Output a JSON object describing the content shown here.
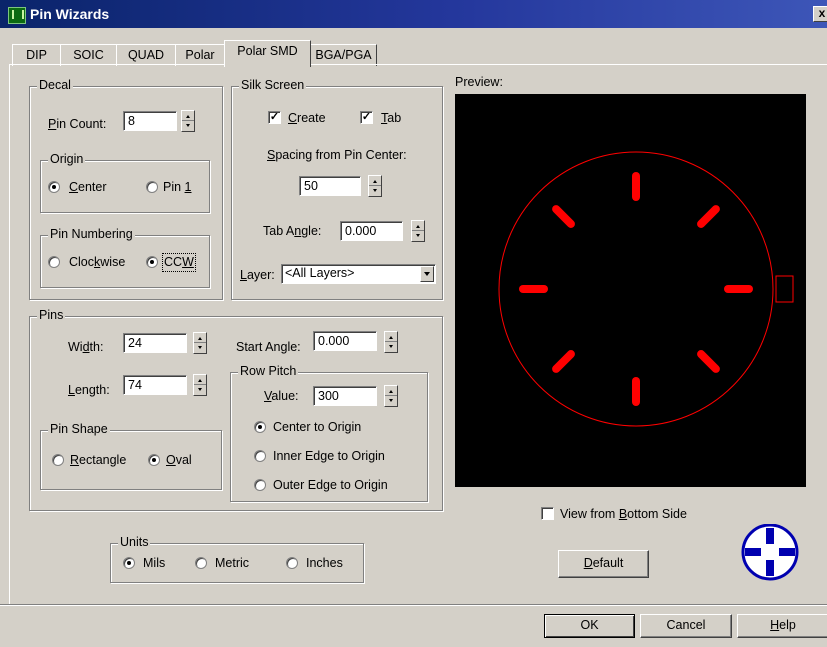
{
  "window": {
    "title": "Pin Wizards",
    "close_label": "x"
  },
  "tabs": [
    "DIP",
    "SOIC",
    "QUAD",
    "Polar",
    "Polar SMD",
    "BGA/PGA"
  ],
  "selected_tab": "Polar SMD",
  "decal": {
    "label": "Decal",
    "pin_count_label": "Pin Count:",
    "pin_count": "8",
    "origin": {
      "label": "Origin",
      "options": [
        "Center",
        "Pin 1"
      ],
      "selected": "Center"
    },
    "pin_numbering": {
      "label": "Pin Numbering",
      "options": [
        "Clockwise",
        "CCW"
      ],
      "selected": "CCW"
    }
  },
  "silk_screen": {
    "label": "Silk Screen",
    "create_label": "Create",
    "create_checked": true,
    "tab_label": "Tab",
    "tab_checked": true,
    "spacing_label": "Spacing from Pin Center:",
    "spacing": "50",
    "tab_angle_label": "Tab Angle:",
    "tab_angle": "0.000",
    "layer_label": "Layer:",
    "layer": "<All Layers>"
  },
  "pins": {
    "label": "Pins",
    "width_label": "Width:",
    "width": "24",
    "length_label": "Length:",
    "length": "74",
    "start_angle_label": "Start Angle:",
    "start_angle": "0.000",
    "pin_shape": {
      "label": "Pin Shape",
      "options": [
        "Rectangle",
        "Oval"
      ],
      "selected": "Oval"
    },
    "row_pitch": {
      "label": "Row Pitch",
      "value_label": "Value:",
      "value": "300",
      "options": [
        "Center to Origin",
        "Inner Edge to Origin",
        "Outer Edge to Origin"
      ],
      "selected": "Center to Origin"
    }
  },
  "units": {
    "label": "Units",
    "options": [
      "Mils",
      "Metric",
      "Inches"
    ],
    "selected": "Mils"
  },
  "preview": {
    "label": "Preview:",
    "background": "#000000",
    "outline_color": "#ff0000",
    "pad_color": "#ff0000",
    "pin_count": 8,
    "view_bottom_label": "View from Bottom Side",
    "view_bottom_checked": false
  },
  "buttons": {
    "default": "Default",
    "ok": "OK",
    "cancel": "Cancel",
    "help": "Help"
  },
  "icons": {
    "nav": "crosshair-navigation-icon",
    "app": "pin-wizard-app-icon"
  }
}
